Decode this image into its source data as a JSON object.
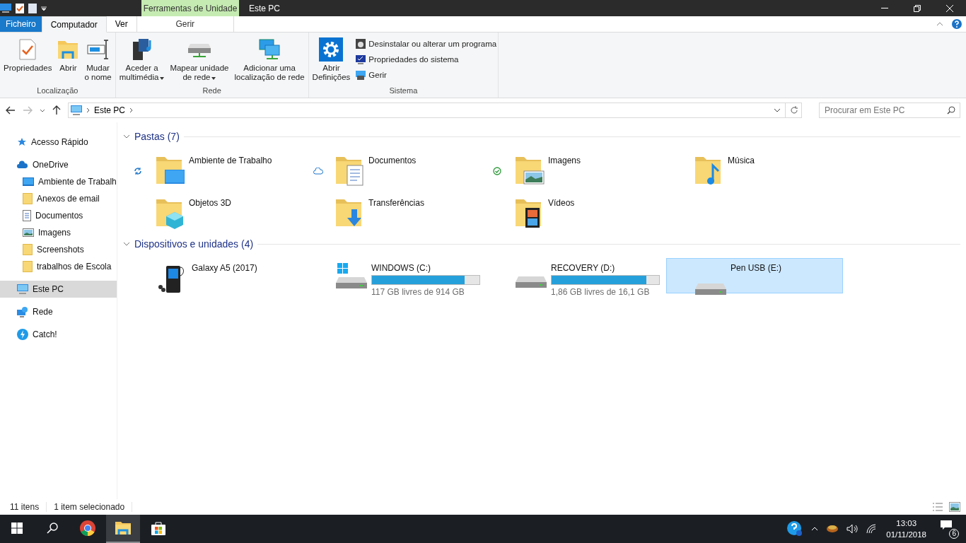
{
  "title_bar": {
    "context_tab": "Ferramentas de Unidade",
    "title": "Este PC"
  },
  "ribbon_tabs": [
    {
      "label": "Ficheiro",
      "kind": "file",
      "selected": false
    },
    {
      "label": "Computador",
      "kind": "tab",
      "selected": true
    },
    {
      "label": "Ver",
      "kind": "tab",
      "selected": false
    },
    {
      "label": "Gerir",
      "kind": "context",
      "selected": false
    }
  ],
  "ribbon_groups": [
    {
      "name": "Localização",
      "commands": [
        {
          "kind": "properties",
          "lines": [
            "Propriedades"
          ]
        },
        {
          "kind": "open",
          "lines": [
            "Abrir"
          ]
        },
        {
          "kind": "rename",
          "lines": [
            "Mudar",
            "o nome"
          ]
        }
      ]
    },
    {
      "name": "Rede",
      "commands": [
        {
          "kind": "media",
          "lines": [
            "Aceder a",
            "multimédia"
          ],
          "has_menu": true
        },
        {
          "kind": "map_drive",
          "lines": [
            "Mapear unidade",
            "de rede"
          ],
          "has_menu": true
        },
        {
          "kind": "add_location",
          "lines": [
            "Adicionar uma",
            "localização de rede"
          ]
        }
      ]
    },
    {
      "name": "Sistema",
      "commands": [
        {
          "kind": "settings",
          "lines": [
            "Abrir",
            "Definições"
          ]
        }
      ],
      "small_commands": [
        {
          "kind": "uninstall",
          "label": "Desinstalar ou alterar um programa"
        },
        {
          "kind": "system",
          "label": "Propriedades do sistema"
        },
        {
          "kind": "manage",
          "label": "Gerir"
        }
      ]
    }
  ],
  "address": {
    "path": [
      "Este PC"
    ],
    "search_placeholder": "Procurar em Este PC"
  },
  "sidebar": [
    {
      "label": "Acesso Rápido",
      "kind": "star",
      "selected": false
    },
    {
      "label": "OneDrive",
      "kind": "cloud",
      "selected": false,
      "children": [
        {
          "label": "Ambiente de Trabalh",
          "kind": "desktop",
          "selected": false
        },
        {
          "label": "Anexos de email",
          "kind": "folder",
          "selected": false
        },
        {
          "label": "Documentos",
          "kind": "document",
          "selected": false
        },
        {
          "label": "Imagens",
          "kind": "pictures",
          "selected": false
        },
        {
          "label": "Screenshots",
          "kind": "folder",
          "selected": false
        },
        {
          "label": "trabalhos de Escola",
          "kind": "folder",
          "selected": false
        }
      ]
    },
    {
      "label": "Este PC",
      "kind": "pc",
      "selected": true
    },
    {
      "label": "Rede",
      "kind": "network",
      "selected": false
    },
    {
      "label": "Catch!",
      "kind": "catch",
      "selected": false
    }
  ],
  "folders": {
    "title": "Pastas (7)",
    "expanded": true,
    "items": [
      {
        "name": "Ambiente de Trabalho",
        "kind": "desktop",
        "status": {
          "kind": "syncing"
        }
      },
      {
        "name": "Documentos",
        "kind": "documents",
        "status": {
          "kind": "online"
        }
      },
      {
        "name": "Imagens",
        "kind": "pictures",
        "status": {
          "kind": "available"
        }
      },
      {
        "name": "Música",
        "kind": "music"
      },
      {
        "name": "Objetos 3D",
        "kind": "objects3d"
      },
      {
        "name": "Transferências",
        "kind": "downloads"
      },
      {
        "name": "Vídeos",
        "kind": "videos"
      }
    ]
  },
  "devices": {
    "title": "Dispositivos e unidades (4)",
    "expanded": true,
    "items": [
      {
        "name": "Galaxy A5 (2017)",
        "kind": "phone",
        "selected": false
      },
      {
        "name": "WINDOWS (C:)",
        "kind": "system_drive",
        "selected": false,
        "level": 0.86,
        "free": "117 GB livres de 914 GB"
      },
      {
        "name": "RECOVERY (D:)",
        "kind": "drive",
        "selected": false,
        "level": 0.88,
        "free": "1,86 GB livres de 16,1 GB"
      },
      {
        "name": "Pen USB (E:)",
        "kind": "usb",
        "selected": true
      }
    ]
  },
  "status_bar": {
    "count": "11 itens",
    "selection": "1 item selecionado"
  },
  "taskbar": {
    "apps": [
      {
        "kind": "start",
        "selected": false
      },
      {
        "kind": "search",
        "selected": false
      },
      {
        "kind": "chrome",
        "selected": false
      },
      {
        "kind": "explorer",
        "selected": true
      },
      {
        "kind": "store",
        "selected": false
      }
    ],
    "time": "13:03",
    "date": "01/11/2018",
    "notifications": "6"
  }
}
